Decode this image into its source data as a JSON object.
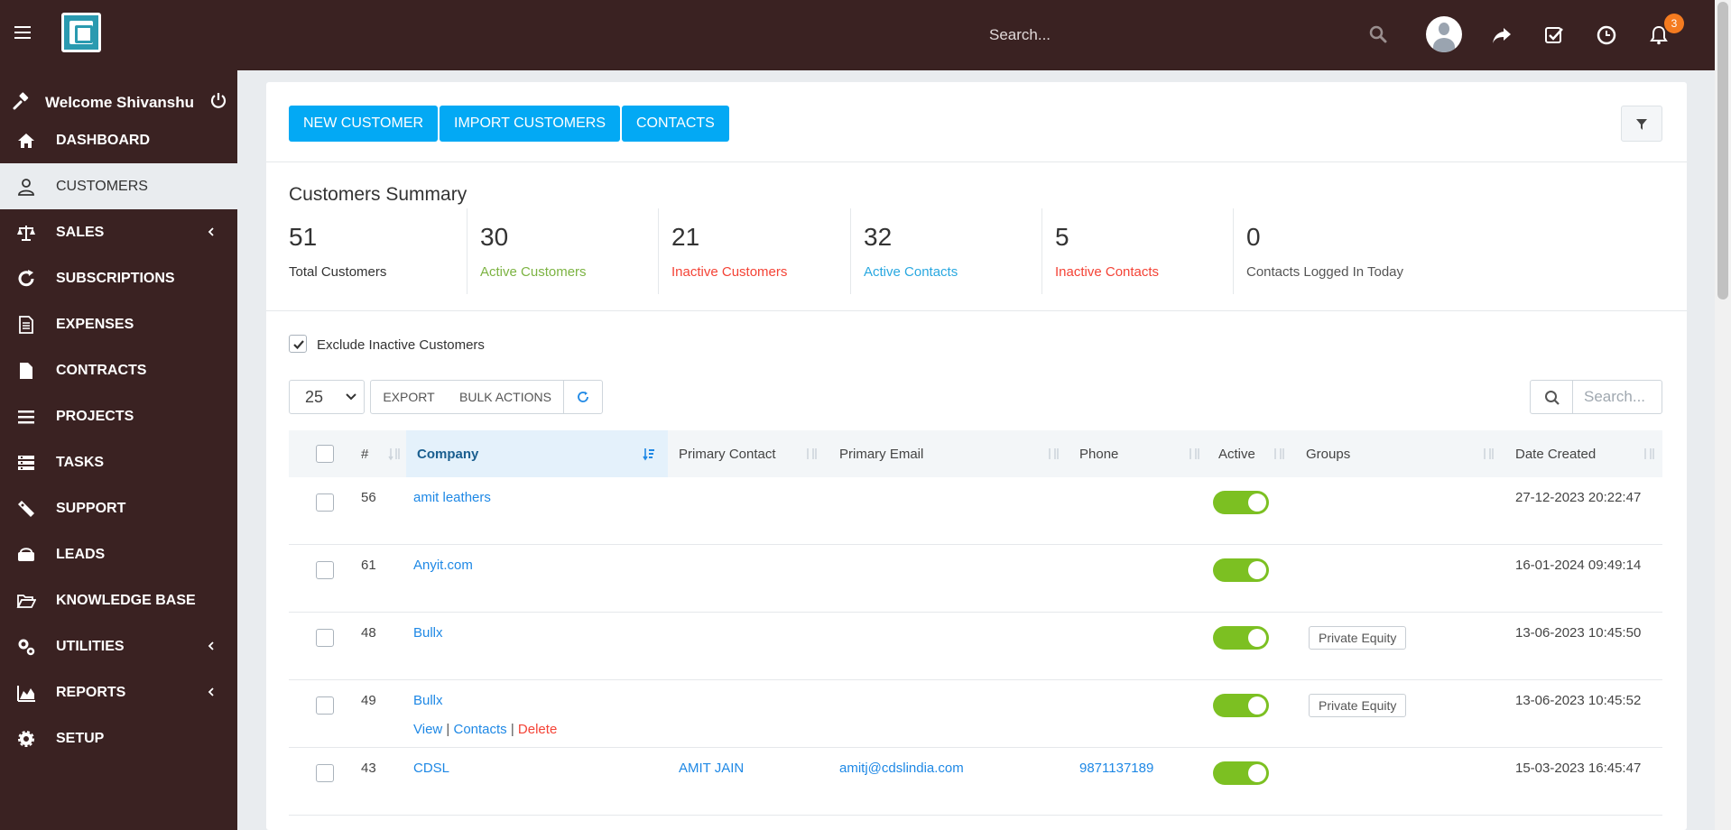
{
  "topbar": {
    "search_placeholder": "Search...",
    "notification_count": "3"
  },
  "sidebar": {
    "welcome": "Welcome Shivanshu",
    "items": [
      {
        "label": "DASHBOARD",
        "icon": "home-icon"
      },
      {
        "label": "CUSTOMERS",
        "icon": "user-icon",
        "active": true
      },
      {
        "label": "SALES",
        "icon": "scale-icon",
        "chevron": true
      },
      {
        "label": "SUBSCRIPTIONS",
        "icon": "refresh-icon"
      },
      {
        "label": "EXPENSES",
        "icon": "document-icon"
      },
      {
        "label": "CONTRACTS",
        "icon": "file-icon"
      },
      {
        "label": "PROJECTS",
        "icon": "bars-icon"
      },
      {
        "label": "TASKS",
        "icon": "tasks-icon"
      },
      {
        "label": "SUPPORT",
        "icon": "ticket-icon"
      },
      {
        "label": "LEADS",
        "icon": "leads-icon"
      },
      {
        "label": "KNOWLEDGE BASE",
        "icon": "folder-open-icon"
      },
      {
        "label": "UTILITIES",
        "icon": "gears-icon",
        "chevron": true
      },
      {
        "label": "REPORTS",
        "icon": "area-chart-icon",
        "chevron": true
      },
      {
        "label": "SETUP",
        "icon": "gear-icon"
      }
    ]
  },
  "toolbar": {
    "new_customer": "NEW CUSTOMER",
    "import_customers": "IMPORT CUSTOMERS",
    "contacts": "CONTACTS"
  },
  "summary": {
    "title": "Customers Summary",
    "stats": [
      {
        "value": "51",
        "label": "Total Customers",
        "color": "#333333"
      },
      {
        "value": "30",
        "label": "Active Customers",
        "color": "#7cb342"
      },
      {
        "value": "21",
        "label": "Inactive Customers",
        "color": "#f44336"
      },
      {
        "value": "32",
        "label": "Active Contacts",
        "color": "#29a8e0"
      },
      {
        "value": "5",
        "label": "Inactive Contacts",
        "color": "#f44336"
      },
      {
        "value": "0",
        "label": "Contacts Logged In Today",
        "color": "#555555"
      }
    ]
  },
  "filters": {
    "exclude_inactive": "Exclude Inactive Customers"
  },
  "datatable": {
    "page_length": "25",
    "export": "EXPORT",
    "bulk_actions": "BULK ACTIONS",
    "search_placeholder": "Search...",
    "columns": [
      "#",
      "Company",
      "Primary Contact",
      "Primary Email",
      "Phone",
      "Active",
      "Groups",
      "Date Created"
    ],
    "rows": [
      {
        "id": "56",
        "company": "amit leathers",
        "contact": "",
        "email": "",
        "phone": "",
        "group": "",
        "date": "27-12-2023 20:22:47"
      },
      {
        "id": "61",
        "company": "Anyit.com",
        "contact": "",
        "email": "",
        "phone": "",
        "group": "",
        "date": "16-01-2024 09:49:14"
      },
      {
        "id": "48",
        "company": "Bullx",
        "contact": "",
        "email": "",
        "phone": "",
        "group": "Private Equity",
        "date": "13-06-2023 10:45:50"
      },
      {
        "id": "49",
        "company": "Bullx",
        "contact": "",
        "email": "",
        "phone": "",
        "group": "Private Equity",
        "date": "13-06-2023 10:45:52",
        "actions": true
      },
      {
        "id": "43",
        "company": "CDSL",
        "contact": "AMIT JAIN",
        "email": "amitj@cdslindia.com",
        "phone": "9871137189",
        "group": "",
        "date": "15-03-2023 16:45:47"
      }
    ],
    "row_actions": {
      "view": "View",
      "contacts": "Contacts",
      "delete": "Delete"
    }
  },
  "colors": {
    "brand_dark": "#3a2222",
    "accent_blue": "#03a9f4",
    "toggle_green": "#7cc022"
  }
}
